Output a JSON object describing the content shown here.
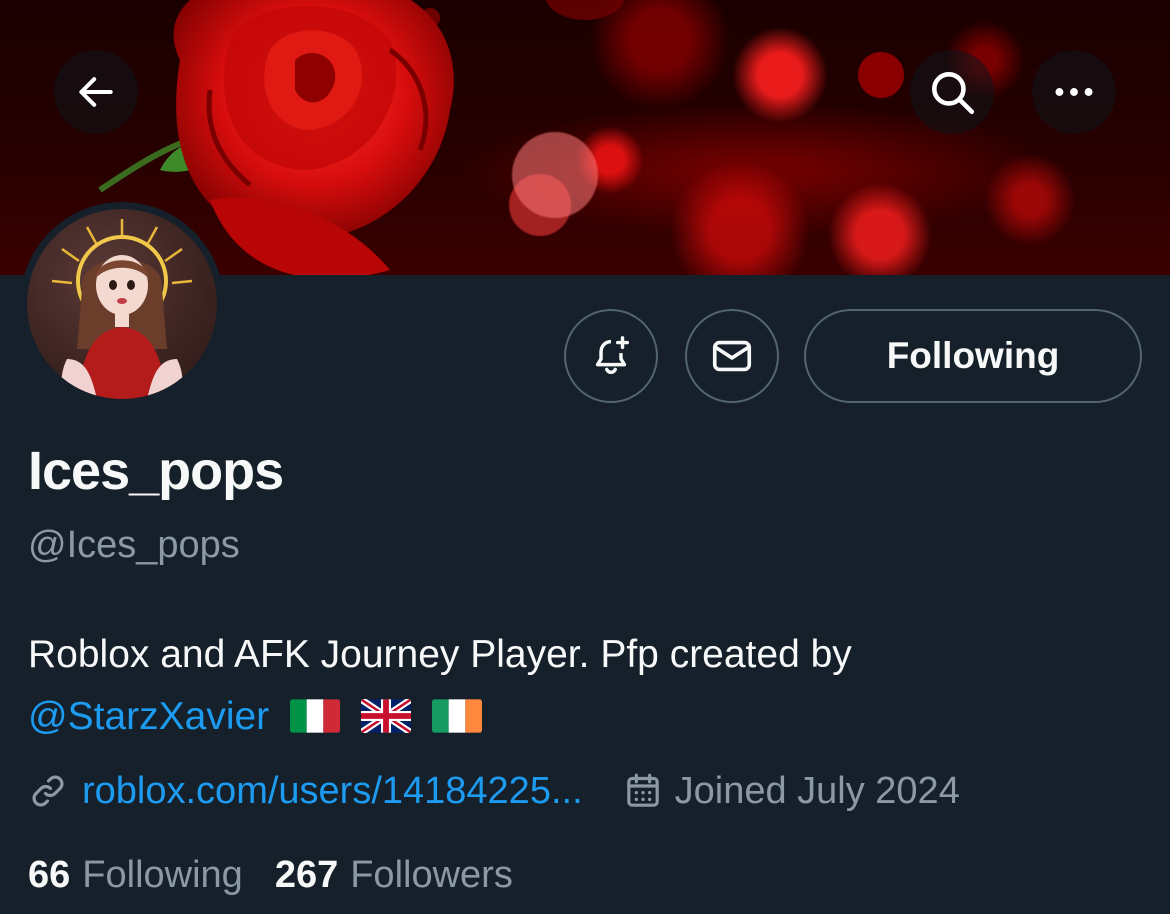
{
  "header": {
    "back_icon": "arrow-left-icon",
    "search_icon": "search-icon",
    "more_icon": "more-horizontal-icon"
  },
  "profile": {
    "display_name": "Ices_pops",
    "handle": "@Ices_pops",
    "bio_text": "Roblox and AFK Journey Player. Pfp created by",
    "bio_mention": "@StarzXavier",
    "bio_flags": [
      "italy-flag",
      "uk-flag",
      "ireland-flag"
    ],
    "website": "roblox.com/users/14184225...",
    "joined": "Joined July 2024",
    "following_count": "66",
    "following_label": "Following",
    "followers_count": "267",
    "followers_label": "Followers"
  },
  "actions": {
    "notify_icon": "bell-plus-icon",
    "message_icon": "envelope-icon",
    "follow_label": "Following"
  },
  "colors": {
    "background": "#15202b",
    "accent": "#1d9bf0",
    "secondary_text": "#8b98a5",
    "border": "#536471"
  }
}
